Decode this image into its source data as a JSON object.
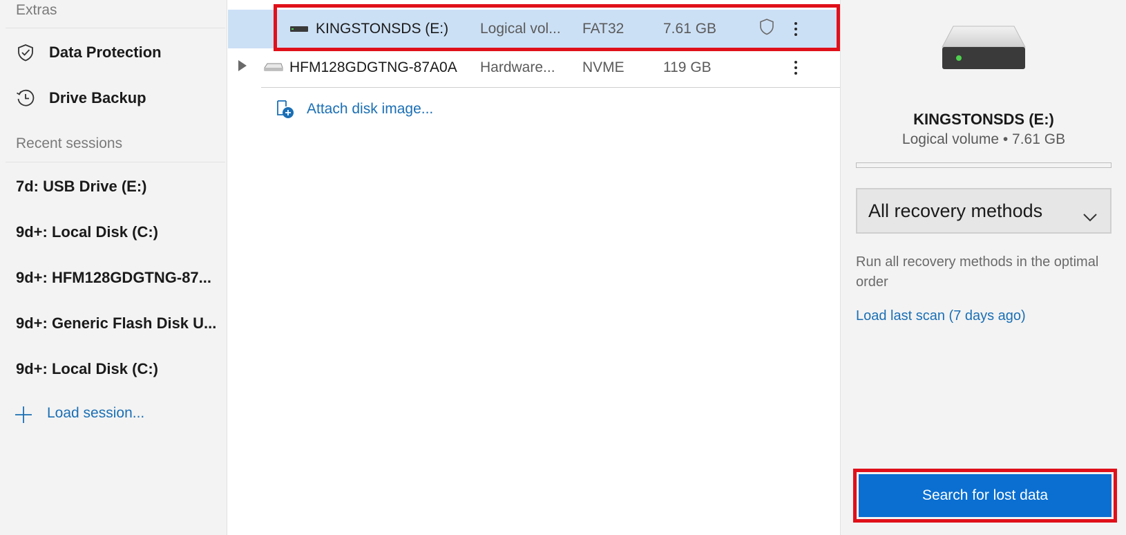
{
  "sidebar": {
    "extras_heading": "Extras",
    "items": [
      {
        "label": "Data Protection",
        "icon": "shield-check-icon"
      },
      {
        "label": "Drive Backup",
        "icon": "clock-history-icon"
      }
    ],
    "recent_heading": "Recent sessions",
    "sessions": [
      "7d: USB Drive (E:)",
      "9d+: Local Disk (C:)",
      "9d+: HFM128GDGTNG-87...",
      "9d+: Generic Flash Disk U...",
      "9d+: Local Disk (C:)"
    ],
    "load_session": "Load session..."
  },
  "drives": [
    {
      "name": "KINGSTONSDS (E:)",
      "type": "Logical vol...",
      "fs": "FAT32",
      "size": "7.61 GB",
      "selected": true,
      "protected": true
    },
    {
      "name": "HFM128GDGTNG-87A0A",
      "type": "Hardware...",
      "fs": "NVME",
      "size": "119 GB",
      "selected": false,
      "expandable": true
    }
  ],
  "attach_label": "Attach disk image...",
  "panel": {
    "title": "KINGSTONSDS (E:)",
    "subtitle": "Logical volume • 7.61 GB",
    "usage_fraction": 0.0,
    "method": "All recovery methods",
    "description": "Run all recovery methods in the optimal order",
    "load_last_scan": "Load last scan (7 days ago)",
    "cta": "Search for lost data"
  },
  "colors": {
    "accent": "#0a6fd1",
    "link": "#1a6fb5",
    "selected_row": "#cce0f5",
    "highlight_outline": "#e0101a"
  }
}
